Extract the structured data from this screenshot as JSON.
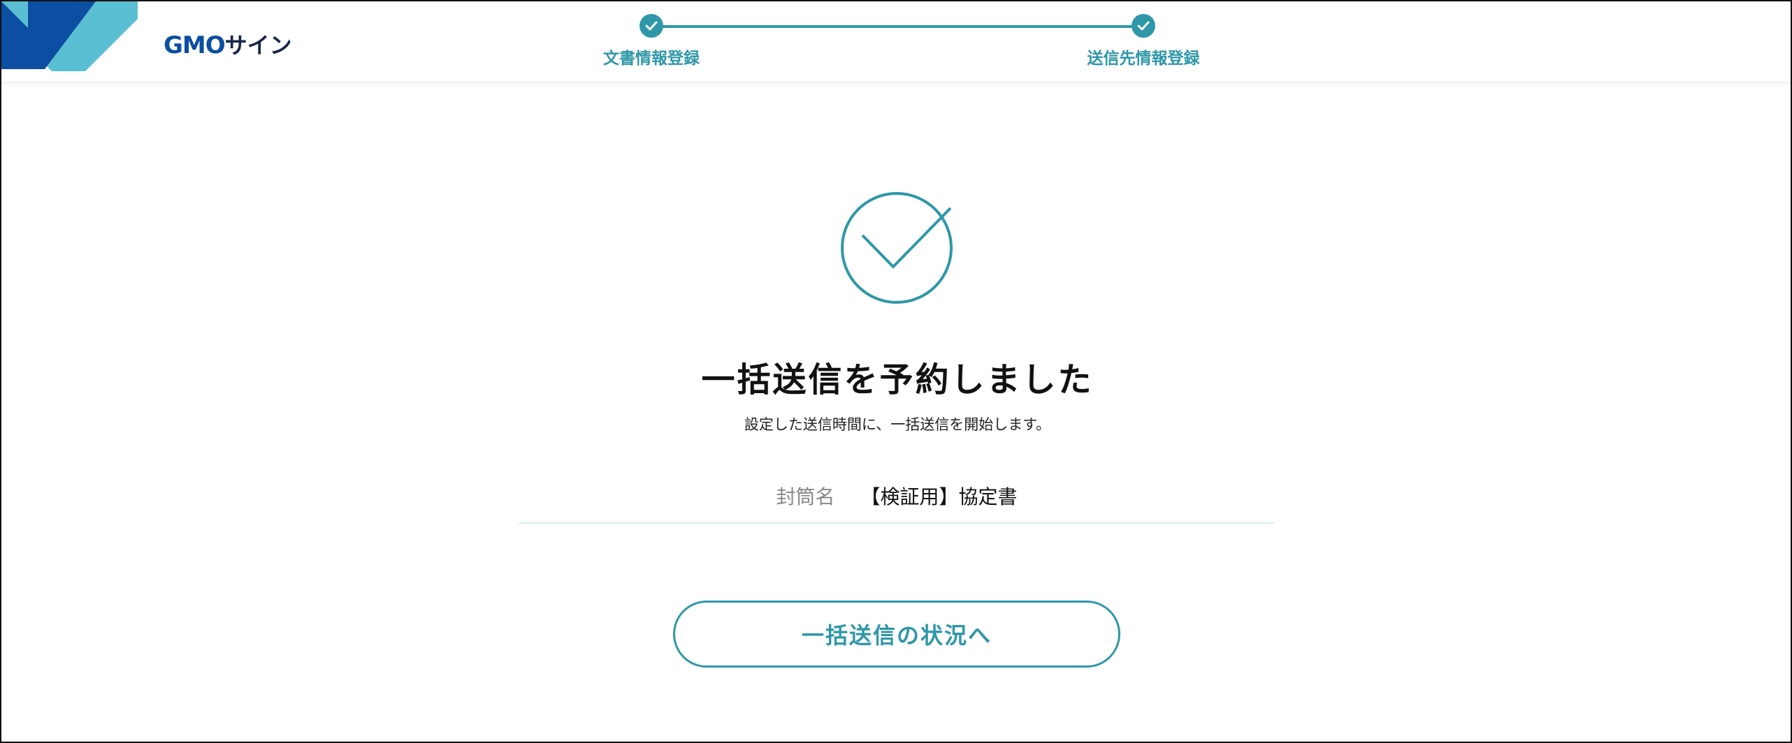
{
  "header": {
    "logo_text": "GMO",
    "logo_kana": "サイン",
    "steps": [
      {
        "label": "文書情報登録",
        "done": true
      },
      {
        "label": "送信先情報登録",
        "done": true
      }
    ]
  },
  "result": {
    "icon": "check-circle-icon",
    "title": "一括送信を予約しました",
    "message": "設定した送信時間に、一括送信を開始します。"
  },
  "envelope": {
    "label": "封筒名",
    "value": "【検証用】協定書"
  },
  "actions": {
    "status_button_label": "一括送信の状況へ"
  },
  "colors": {
    "accent": "#2e97a8",
    "logo_blue": "#0b4ea2",
    "logo_light": "#5bbfd3",
    "text": "#111111"
  }
}
